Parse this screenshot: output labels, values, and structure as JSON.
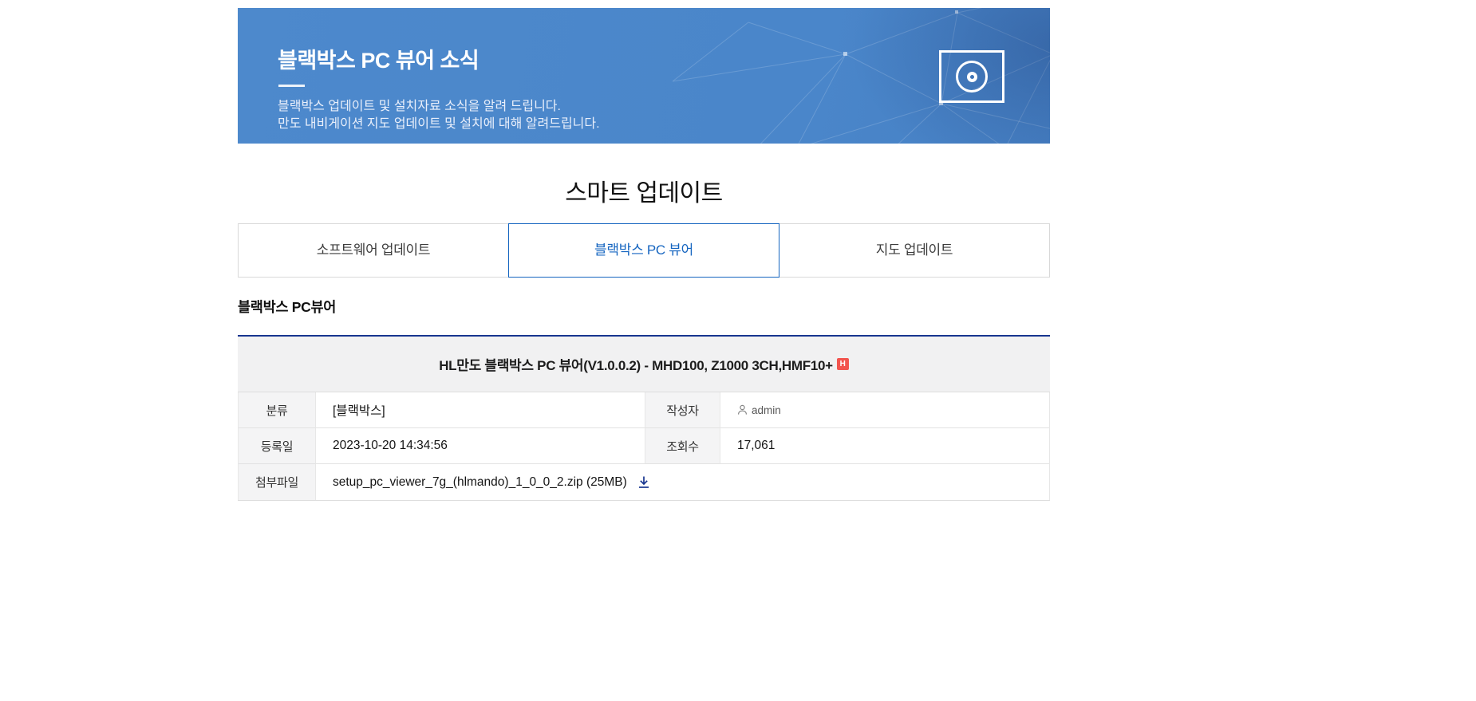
{
  "banner": {
    "title": "블랙박스 PC 뷰어 소식",
    "subtitle_line1": "블랙박스 업데이트 및 설치자료 소식을 알려 드립니다.",
    "subtitle_line2": "만도 내비게이션 지도 업데이트 및 설치에 대해 알려드립니다.",
    "background_color": "#4a86ca",
    "icon": "disc-icon"
  },
  "page": {
    "heading": "스마트 업데이트"
  },
  "tabs": {
    "active_index": 1,
    "active_color": "#1565c0",
    "items": [
      {
        "label": "소프트웨어 업데이트"
      },
      {
        "label": "블랙박스 PC 뷰어"
      },
      {
        "label": "지도 업데이트"
      }
    ]
  },
  "section": {
    "heading": "블랙박스 PC뷰어"
  },
  "post": {
    "title": "HL만도 블랙박스 PC 뷰어(V1.0.0.2) - MHD100, Z1000 3CH,HMF10+",
    "badge": "H",
    "badge_color": "#f2544e",
    "accent_color": "#17358f",
    "rows": {
      "category_label": "분류",
      "category_value": "[블랙박스]",
      "author_label": "작성자",
      "author_value": "admin",
      "date_label": "등록일",
      "date_value": "2023-10-20 14:34:56",
      "views_label": "조회수",
      "views_value": "17,061",
      "attachment_label": "첨부파일",
      "attachment_value": "setup_pc_viewer_7g_(hlmando)_1_0_0_2.zip (25MB)"
    }
  }
}
